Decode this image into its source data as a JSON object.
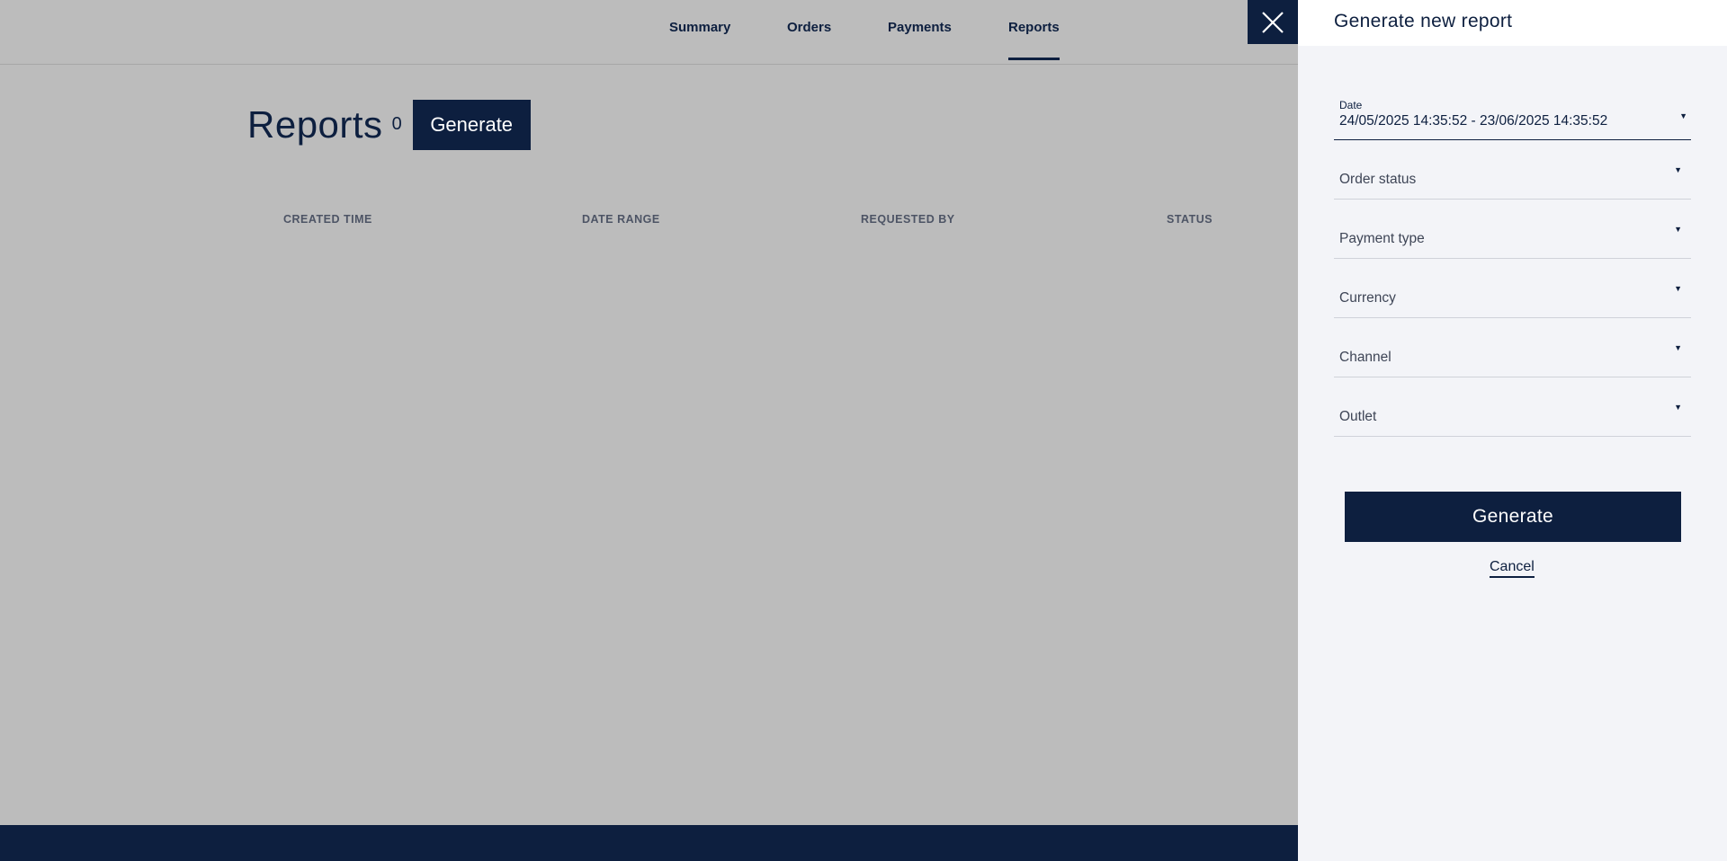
{
  "nav": {
    "tabs": [
      {
        "label": "Summary"
      },
      {
        "label": "Orders"
      },
      {
        "label": "Payments"
      },
      {
        "label": "Reports",
        "active": true
      }
    ]
  },
  "page": {
    "title": "Reports",
    "count": "0",
    "generate_label": "Generate"
  },
  "table": {
    "columns": [
      "CREATED TIME",
      "DATE RANGE",
      "REQUESTED BY",
      "STATUS"
    ]
  },
  "drawer": {
    "close_icon": "close-icon",
    "title": "Generate new report",
    "date": {
      "label": "Date",
      "value": "24/05/2025 14:35:52 - 23/06/2025 14:35:52"
    },
    "filters": [
      {
        "label": "Order status"
      },
      {
        "label": "Payment type"
      },
      {
        "label": "Currency"
      },
      {
        "label": "Channel"
      },
      {
        "label": "Outlet"
      }
    ],
    "generate_label": "Generate",
    "cancel_label": "Cancel"
  },
  "colors": {
    "brand_navy": "#0d1f3f",
    "overlay_gray": "#bcbcbc",
    "drawer_bg": "#f3f4f8"
  }
}
